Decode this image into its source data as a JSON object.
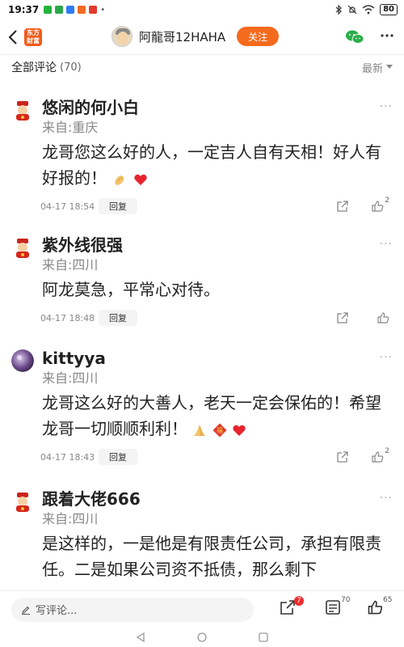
{
  "status_bar": {
    "time": "19:37",
    "battery": "80"
  },
  "header": {
    "app_logo": "东方\n财富",
    "author_name": "阿龍哥12HAHA",
    "follow_label": "关注"
  },
  "section": {
    "title": "全部评论",
    "count": "(70)",
    "sort_label": "最新"
  },
  "comments": [
    {
      "name": "悠闲的何小白",
      "from": "来自:重庆",
      "text": "龙哥您这么好的人，一定吉人自有天相！好人有好报的！",
      "date": "04-17 18:54",
      "reply": "回复",
      "likes": "2",
      "emojis": [
        "clap-emoji",
        "heart-emoji"
      ]
    },
    {
      "name": "紫外线很强",
      "from": "来自:四川",
      "text": "阿龙莫急，平常心对待。",
      "date": "04-17 18:48",
      "reply": "回复",
      "likes": "",
      "emojis": []
    },
    {
      "name": "kittyya",
      "from": "来自:四川",
      "text": "龙哥这么好的大善人，老天一定会保佑的！希望龙哥一切顺顺利利！",
      "date": "04-17 18:43",
      "reply": "回复",
      "likes": "2",
      "emojis": [
        "pray-emoji",
        "fortune-emoji",
        "heart-emoji"
      ]
    },
    {
      "name": "跟着大佬666",
      "from": "来自:四川",
      "text": "是这样的，一是他是有限责任公司，承担有限责任。二是如果公司资不抵债，那么剩下",
      "date": "",
      "reply": "",
      "likes": "",
      "emojis": []
    }
  ],
  "bottom_bar": {
    "placeholder": "写评论...",
    "share_badge": "7",
    "comment_count": "70",
    "like_count": "65"
  },
  "colors": {
    "accent": "#f46b1d",
    "heart": "#e8242e",
    "badge": "#ee2c2c"
  }
}
